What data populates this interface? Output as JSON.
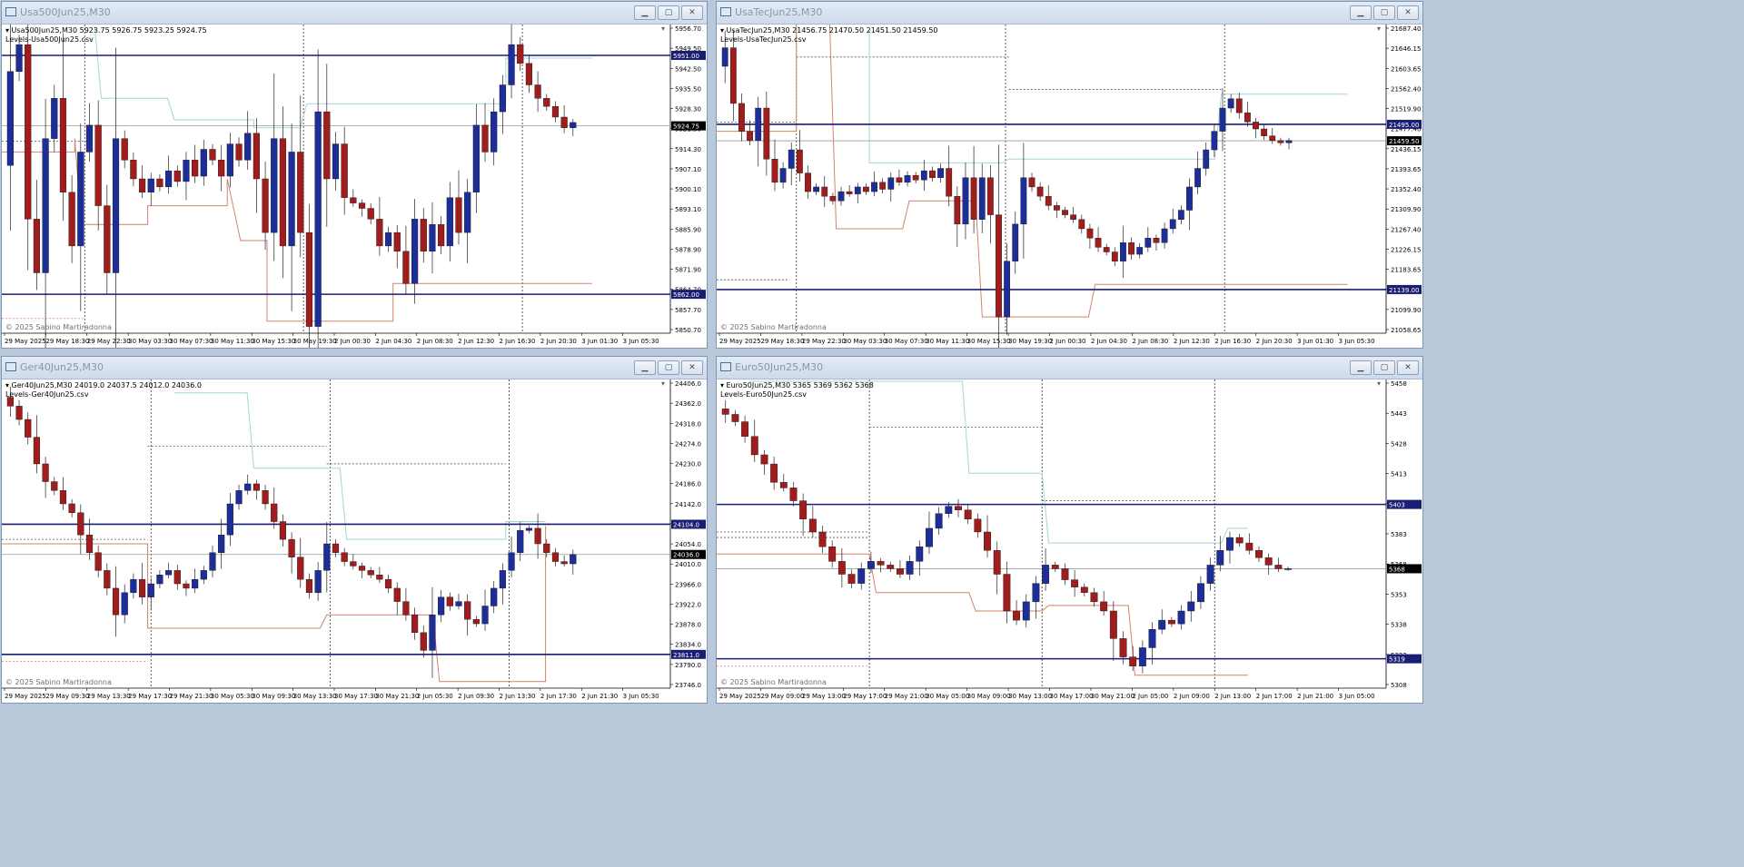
{
  "copyright": "© 2025 Sabino Martiradonna",
  "colors": {
    "bull": "#1d2d9a",
    "bear": "#a11d1d",
    "level": "#1a1e73",
    "red_line": "#d2826e",
    "teal_line": "#a8d4d6",
    "cursor": "#333333",
    "price_tag": "#000000",
    "label_bg": "#1a1e73"
  },
  "windows": [
    {
      "id": "usa500",
      "title": "Usa500Jun25,M30",
      "info1": "▾ Usa500Jun25,M30  5923.75 5926.75 5923.25 5924.75",
      "info2": "Levels-Usa500Jun25.csv",
      "price_labels": [
        "5956.70",
        "5949.50",
        "5942.50",
        "5935.50",
        "5928.30",
        "5921.30",
        "5914.30",
        "5907.10",
        "5900.10",
        "5893.10",
        "5885.90",
        "5878.90",
        "5871.90",
        "5864.70",
        "5857.70",
        "5850.70"
      ],
      "time_labels": [
        "29 May 2025",
        "29 May 18:30",
        "29 May 22:30",
        "30 May 03:30",
        "30 May 07:30",
        "30 May 11:30",
        "30 May 15:30",
        "30 May 19:30",
        "2 Jun 00:30",
        "2 Jun 04:30",
        "2 Jun 08:30",
        "2 Jun 12:30",
        "2 Jun 16:30",
        "2 Jun 20:30",
        "3 Jun 01:30",
        "3 Jun 05:30"
      ],
      "levels": [
        {
          "price": 5951.0,
          "label": "5951.00"
        },
        {
          "price": 5862.0,
          "label": "5862.00"
        }
      ],
      "current": {
        "price": 5924.75,
        "label": "5924.75"
      },
      "min": 5847.5,
      "max": 5962.5,
      "path": [
        5910,
        5945,
        5955,
        5890,
        5870,
        5920,
        5935,
        5900,
        5880,
        5915,
        5925,
        5895,
        5870,
        5920,
        5912,
        5905,
        5900,
        5905,
        5902,
        5908,
        5904,
        5912,
        5906,
        5916,
        5912,
        5906,
        5918,
        5912,
        5922,
        5905,
        5885,
        5920,
        5880,
        5915,
        5885,
        5850,
        5930,
        5905,
        5918,
        5898,
        5896,
        5894,
        5890,
        5880,
        5885,
        5878,
        5866,
        5890,
        5878,
        5888,
        5880,
        5898,
        5885,
        5900,
        5925,
        5915,
        5930,
        5940,
        5955,
        5948,
        5940,
        5935,
        5932,
        5928,
        5924,
        5926
      ],
      "red_line": [
        [
          0.0,
          5915
        ],
        [
          0.11,
          5915
        ],
        [
          0.11,
          5920
        ],
        [
          0.12,
          5888
        ],
        [
          0.22,
          5888
        ],
        [
          0.22,
          5895
        ],
        [
          0.34,
          5895
        ],
        [
          0.34,
          5905
        ],
        [
          0.36,
          5882
        ],
        [
          0.4,
          5882
        ],
        [
          0.4,
          5852
        ],
        [
          0.59,
          5852
        ],
        [
          0.59,
          5866
        ],
        [
          0.89,
          5866
        ]
      ],
      "teal_line": [
        [
          0.14,
          5962
        ],
        [
          0.15,
          5935
        ],
        [
          0.25,
          5935
        ],
        [
          0.26,
          5927
        ],
        [
          0.38,
          5927
        ],
        [
          0.38,
          5924
        ],
        [
          0.45,
          5924
        ],
        [
          0.46,
          5933
        ],
        [
          0.76,
          5933
        ],
        [
          0.76,
          5950
        ],
        [
          0.89,
          5950
        ]
      ],
      "vlines": [
        0.125,
        0.455,
        0.785
      ],
      "dotted": [
        [
          0.0,
          0.13,
          5919
        ],
        [
          0.0,
          0.125,
          5853
        ]
      ]
    },
    {
      "id": "usatec",
      "title": "UsaTecJun25,M30",
      "info1": "▾ UsaTecJun25,M30  21456.75 21470.50 21451.50 21459.50",
      "info2": "Levels-UsaTecJun25.csv",
      "price_labels": [
        "21687.40",
        "21646.15",
        "21603.65",
        "21562.40",
        "21519.90",
        "21477.40",
        "21436.15",
        "21393.65",
        "21352.40",
        "21309.90",
        "21267.40",
        "21226.15",
        "21183.65",
        "21141.15",
        "21099.90",
        "21058.65"
      ],
      "time_labels": [
        "29 May 2025",
        "29 May 18:30",
        "29 May 22:30",
        "30 May 03:30",
        "30 May 07:30",
        "30 May 11:30",
        "30 May 15:30",
        "30 May 19:30",
        "2 Jun 00:30",
        "2 Jun 04:30",
        "2 Jun 08:30",
        "2 Jun 12:30",
        "2 Jun 16:30",
        "2 Jun 20:30",
        "3 Jun 01:30",
        "3 Jun 05:30"
      ],
      "levels": [
        {
          "price": 21495.0,
          "label": "21495.00"
        },
        {
          "price": 21139.0,
          "label": "21139.00"
        }
      ],
      "current": {
        "price": 21459.5,
        "label": "21459.50"
      },
      "min": 21045,
      "max": 21710,
      "path": [
        21620,
        21660,
        21540,
        21480,
        21460,
        21530,
        21420,
        21370,
        21400,
        21440,
        21390,
        21350,
        21360,
        21340,
        21330,
        21350,
        21345,
        21360,
        21350,
        21370,
        21355,
        21380,
        21370,
        21385,
        21375,
        21395,
        21380,
        21400,
        21340,
        21280,
        21380,
        21290,
        21380,
        21300,
        21080,
        21200,
        21280,
        21380,
        21360,
        21340,
        21320,
        21310,
        21300,
        21290,
        21270,
        21250,
        21230,
        21220,
        21200,
        21240,
        21215,
        21230,
        21250,
        21240,
        21270,
        21290,
        21310,
        21360,
        21400,
        21440,
        21480,
        21530,
        21550,
        21520,
        21500,
        21485,
        21470,
        21460,
        21455,
        21460
      ],
      "red_line": [
        [
          0.0,
          21480
        ],
        [
          0.12,
          21480
        ],
        [
          0.12,
          21720
        ],
        [
          0.17,
          21720
        ],
        [
          0.18,
          21270
        ],
        [
          0.28,
          21270
        ],
        [
          0.29,
          21330
        ],
        [
          0.39,
          21330
        ],
        [
          0.4,
          21080
        ],
        [
          0.56,
          21080
        ],
        [
          0.57,
          21150
        ],
        [
          0.95,
          21150
        ]
      ],
      "teal_line": [
        [
          0.23,
          21700
        ],
        [
          0.23,
          21412
        ],
        [
          0.43,
          21412
        ],
        [
          0.44,
          21420
        ],
        [
          0.75,
          21420
        ],
        [
          0.76,
          21560
        ],
        [
          0.95,
          21560
        ]
      ],
      "vlines": [
        0.12,
        0.435,
        0.765
      ],
      "dotted": [
        [
          0.0,
          0.11,
          21160
        ],
        [
          0.0,
          0.12,
          21500
        ],
        [
          0.12,
          0.44,
          21640
        ],
        [
          0.44,
          0.76,
          21570
        ]
      ]
    },
    {
      "id": "ger40",
      "title": "Ger40Jun25,M30",
      "info1": "▾ Ger40Jun25,M30  24019.0 24037.5 24012.0 24036.0",
      "info2": "Levels-Ger40Jun25.csv",
      "price_labels": [
        "24406.0",
        "24362.0",
        "24318.0",
        "24274.0",
        "24230.0",
        "24186.0",
        "24142.0",
        "24098.0",
        "24054.0",
        "24010.0",
        "23966.0",
        "23922.0",
        "23878.0",
        "23834.0",
        "23790.0",
        "23746.0"
      ],
      "time_labels": [
        "29 May 2025",
        "29 May 09:30",
        "29 May 13:30",
        "29 May 17:30",
        "29 May 21:30",
        "30 May 05:30",
        "30 May 09:30",
        "30 May 13:30",
        "30 May 17:30",
        "30 May 21:30",
        "2 Jun 05:30",
        "2 Jun 09:30",
        "2 Jun 13:30",
        "2 Jun 17:30",
        "2 Jun 21:30",
        "3 Jun 05:30"
      ],
      "levels": [
        {
          "price": 24104.0,
          "label": "24104.0"
        },
        {
          "price": 23811.0,
          "label": "23811.0"
        }
      ],
      "current": {
        "price": 24036.0,
        "label": "24036.0"
      },
      "min": 23735,
      "max": 24430,
      "path": [
        24390,
        24370,
        24340,
        24300,
        24240,
        24200,
        24180,
        24150,
        24130,
        24080,
        24040,
        24000,
        23960,
        23900,
        23950,
        23980,
        23940,
        23970,
        23990,
        24000,
        23970,
        23960,
        23980,
        24000,
        24040,
        24080,
        24150,
        24180,
        24195,
        24180,
        24150,
        24110,
        24070,
        24030,
        23980,
        23950,
        24000,
        24060,
        24040,
        24020,
        24010,
        24000,
        23990,
        23980,
        23960,
        23930,
        23900,
        23860,
        23820,
        23900,
        23940,
        23920,
        23930,
        23890,
        23880,
        23920,
        23960,
        24000,
        24040,
        24090,
        24095,
        24060,
        24040,
        24020,
        24015,
        24036
      ],
      "red_line": [
        [
          0.0,
          24060
        ],
        [
          0.22,
          24060
        ],
        [
          0.22,
          23870
        ],
        [
          0.48,
          23870
        ],
        [
          0.49,
          23900
        ],
        [
          0.65,
          23900
        ],
        [
          0.66,
          23750
        ],
        [
          0.82,
          23750
        ],
        [
          0.82,
          24100
        ]
      ],
      "teal_line": [
        [
          0.26,
          24400
        ],
        [
          0.37,
          24400
        ],
        [
          0.38,
          24230
        ],
        [
          0.51,
          24230
        ],
        [
          0.52,
          24070
        ],
        [
          0.76,
          24070
        ],
        [
          0.76,
          24110
        ],
        [
          0.82,
          24110
        ]
      ],
      "vlines": [
        0.225,
        0.495,
        0.765
      ],
      "dotted": [
        [
          0.0,
          0.22,
          24070
        ],
        [
          0.0,
          0.22,
          23795
        ],
        [
          0.22,
          0.49,
          24280
        ],
        [
          0.49,
          0.76,
          24240
        ]
      ]
    },
    {
      "id": "euro50",
      "title": "Euro50Jun25,M30",
      "info1": "▾ Euro50Jun25,M30  5365 5369 5362 5368",
      "info2": "Levels-Euro50Jun25.csv",
      "price_labels": [
        "5458",
        "5443",
        "5428",
        "5413",
        "5398",
        "5383",
        "5368",
        "5353",
        "5338",
        "5323",
        "5308"
      ],
      "time_labels": [
        "29 May 2025",
        "29 May 09:00",
        "29 May 13:00",
        "29 May 17:00",
        "29 May 21:00",
        "30 May 05:00",
        "30 May 09:00",
        "30 May 13:00",
        "30 May 17:00",
        "30 May 21:00",
        "2 Jun 05:00",
        "2 Jun 09:00",
        "2 Jun 13:00",
        "2 Jun 17:00",
        "2 Jun 21:00",
        "3 Jun 05:00"
      ],
      "levels": [
        {
          "price": 5403,
          "label": "5403"
        },
        {
          "price": 5319,
          "label": "5319"
        }
      ],
      "current": {
        "price": 5368,
        "label": "5368"
      },
      "min": 5303,
      "max": 5471,
      "path": [
        5455,
        5452,
        5448,
        5440,
        5430,
        5425,
        5415,
        5412,
        5405,
        5395,
        5388,
        5380,
        5372,
        5365,
        5360,
        5368,
        5372,
        5370,
        5368,
        5365,
        5372,
        5380,
        5390,
        5398,
        5402,
        5400,
        5395,
        5388,
        5378,
        5365,
        5345,
        5340,
        5350,
        5360,
        5370,
        5368,
        5362,
        5358,
        5355,
        5350,
        5345,
        5330,
        5320,
        5315,
        5325,
        5335,
        5340,
        5338,
        5345,
        5350,
        5360,
        5370,
        5378,
        5385,
        5382,
        5378,
        5374,
        5370,
        5368,
        5368
      ],
      "red_line": [
        [
          0.0,
          5376
        ],
        [
          0.23,
          5376
        ],
        [
          0.24,
          5355
        ],
        [
          0.38,
          5355
        ],
        [
          0.39,
          5345
        ],
        [
          0.49,
          5345
        ],
        [
          0.5,
          5348
        ],
        [
          0.62,
          5348
        ],
        [
          0.63,
          5310
        ],
        [
          0.8,
          5310
        ]
      ],
      "teal_line": [
        [
          0.05,
          5470
        ],
        [
          0.37,
          5470
        ],
        [
          0.38,
          5420
        ],
        [
          0.49,
          5420
        ],
        [
          0.5,
          5382
        ],
        [
          0.76,
          5382
        ],
        [
          0.77,
          5390
        ],
        [
          0.8,
          5390
        ]
      ],
      "vlines": [
        0.23,
        0.49,
        0.75
      ],
      "dotted": [
        [
          0.0,
          0.23,
          5388
        ],
        [
          0.0,
          0.23,
          5385
        ],
        [
          0.23,
          0.49,
          5445
        ],
        [
          0.49,
          0.75,
          5405
        ],
        [
          0.0,
          0.23,
          5315
        ]
      ]
    }
  ]
}
